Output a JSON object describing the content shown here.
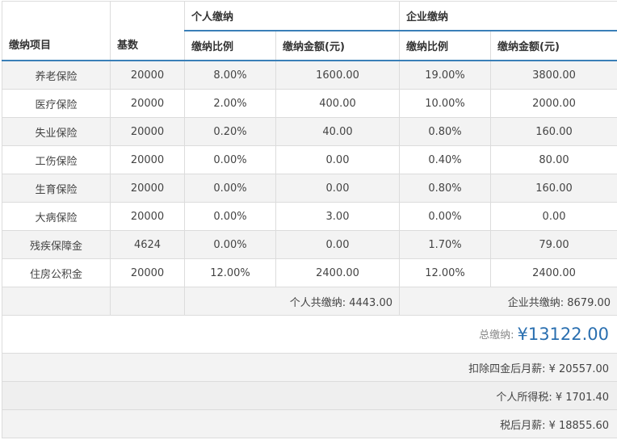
{
  "header": {
    "item": "缴纳项目",
    "base": "基数",
    "personal_group": "个人缴纳",
    "company_group": "企业缴纳",
    "personal_rate": "缴纳比例",
    "personal_amount": "缴纳金额(元)",
    "company_rate": "缴纳比例",
    "company_amount": "缴纳金额(元)"
  },
  "rows": [
    {
      "item": "养老保险",
      "base": "20000",
      "p_rate": "8.00%",
      "p_amt": "1600.00",
      "c_rate": "19.00%",
      "c_amt": "3800.00"
    },
    {
      "item": "医疗保险",
      "base": "20000",
      "p_rate": "2.00%",
      "p_amt": "400.00",
      "c_rate": "10.00%",
      "c_amt": "2000.00"
    },
    {
      "item": "失业保险",
      "base": "20000",
      "p_rate": "0.20%",
      "p_amt": "40.00",
      "c_rate": "0.80%",
      "c_amt": "160.00"
    },
    {
      "item": "工伤保险",
      "base": "20000",
      "p_rate": "0.00%",
      "p_amt": "0.00",
      "c_rate": "0.40%",
      "c_amt": "80.00"
    },
    {
      "item": "生育保险",
      "base": "20000",
      "p_rate": "0.00%",
      "p_amt": "0.00",
      "c_rate": "0.80%",
      "c_amt": "160.00"
    },
    {
      "item": "大病保险",
      "base": "20000",
      "p_rate": "0.00%",
      "p_amt": "3.00",
      "c_rate": "0.00%",
      "c_amt": "0.00"
    },
    {
      "item": "残疾保障金",
      "base": "4624",
      "p_rate": "0.00%",
      "p_amt": "0.00",
      "c_rate": "1.70%",
      "c_amt": "79.00"
    },
    {
      "item": "住房公积金",
      "base": "20000",
      "p_rate": "12.00%",
      "p_amt": "2400.00",
      "c_rate": "12.00%",
      "c_amt": "2400.00"
    }
  ],
  "subtotals": {
    "personal": "个人共缴纳: 4443.00",
    "company": "企业共缴纳: 8679.00"
  },
  "grand_total": {
    "label": "总缴纳:",
    "value": "¥13122.00"
  },
  "summary": [
    "扣除四金后月薪: ¥ 20557.00",
    "个人所得税: ¥ 1701.40",
    "税后月薪: ¥ 18855.60"
  ]
}
